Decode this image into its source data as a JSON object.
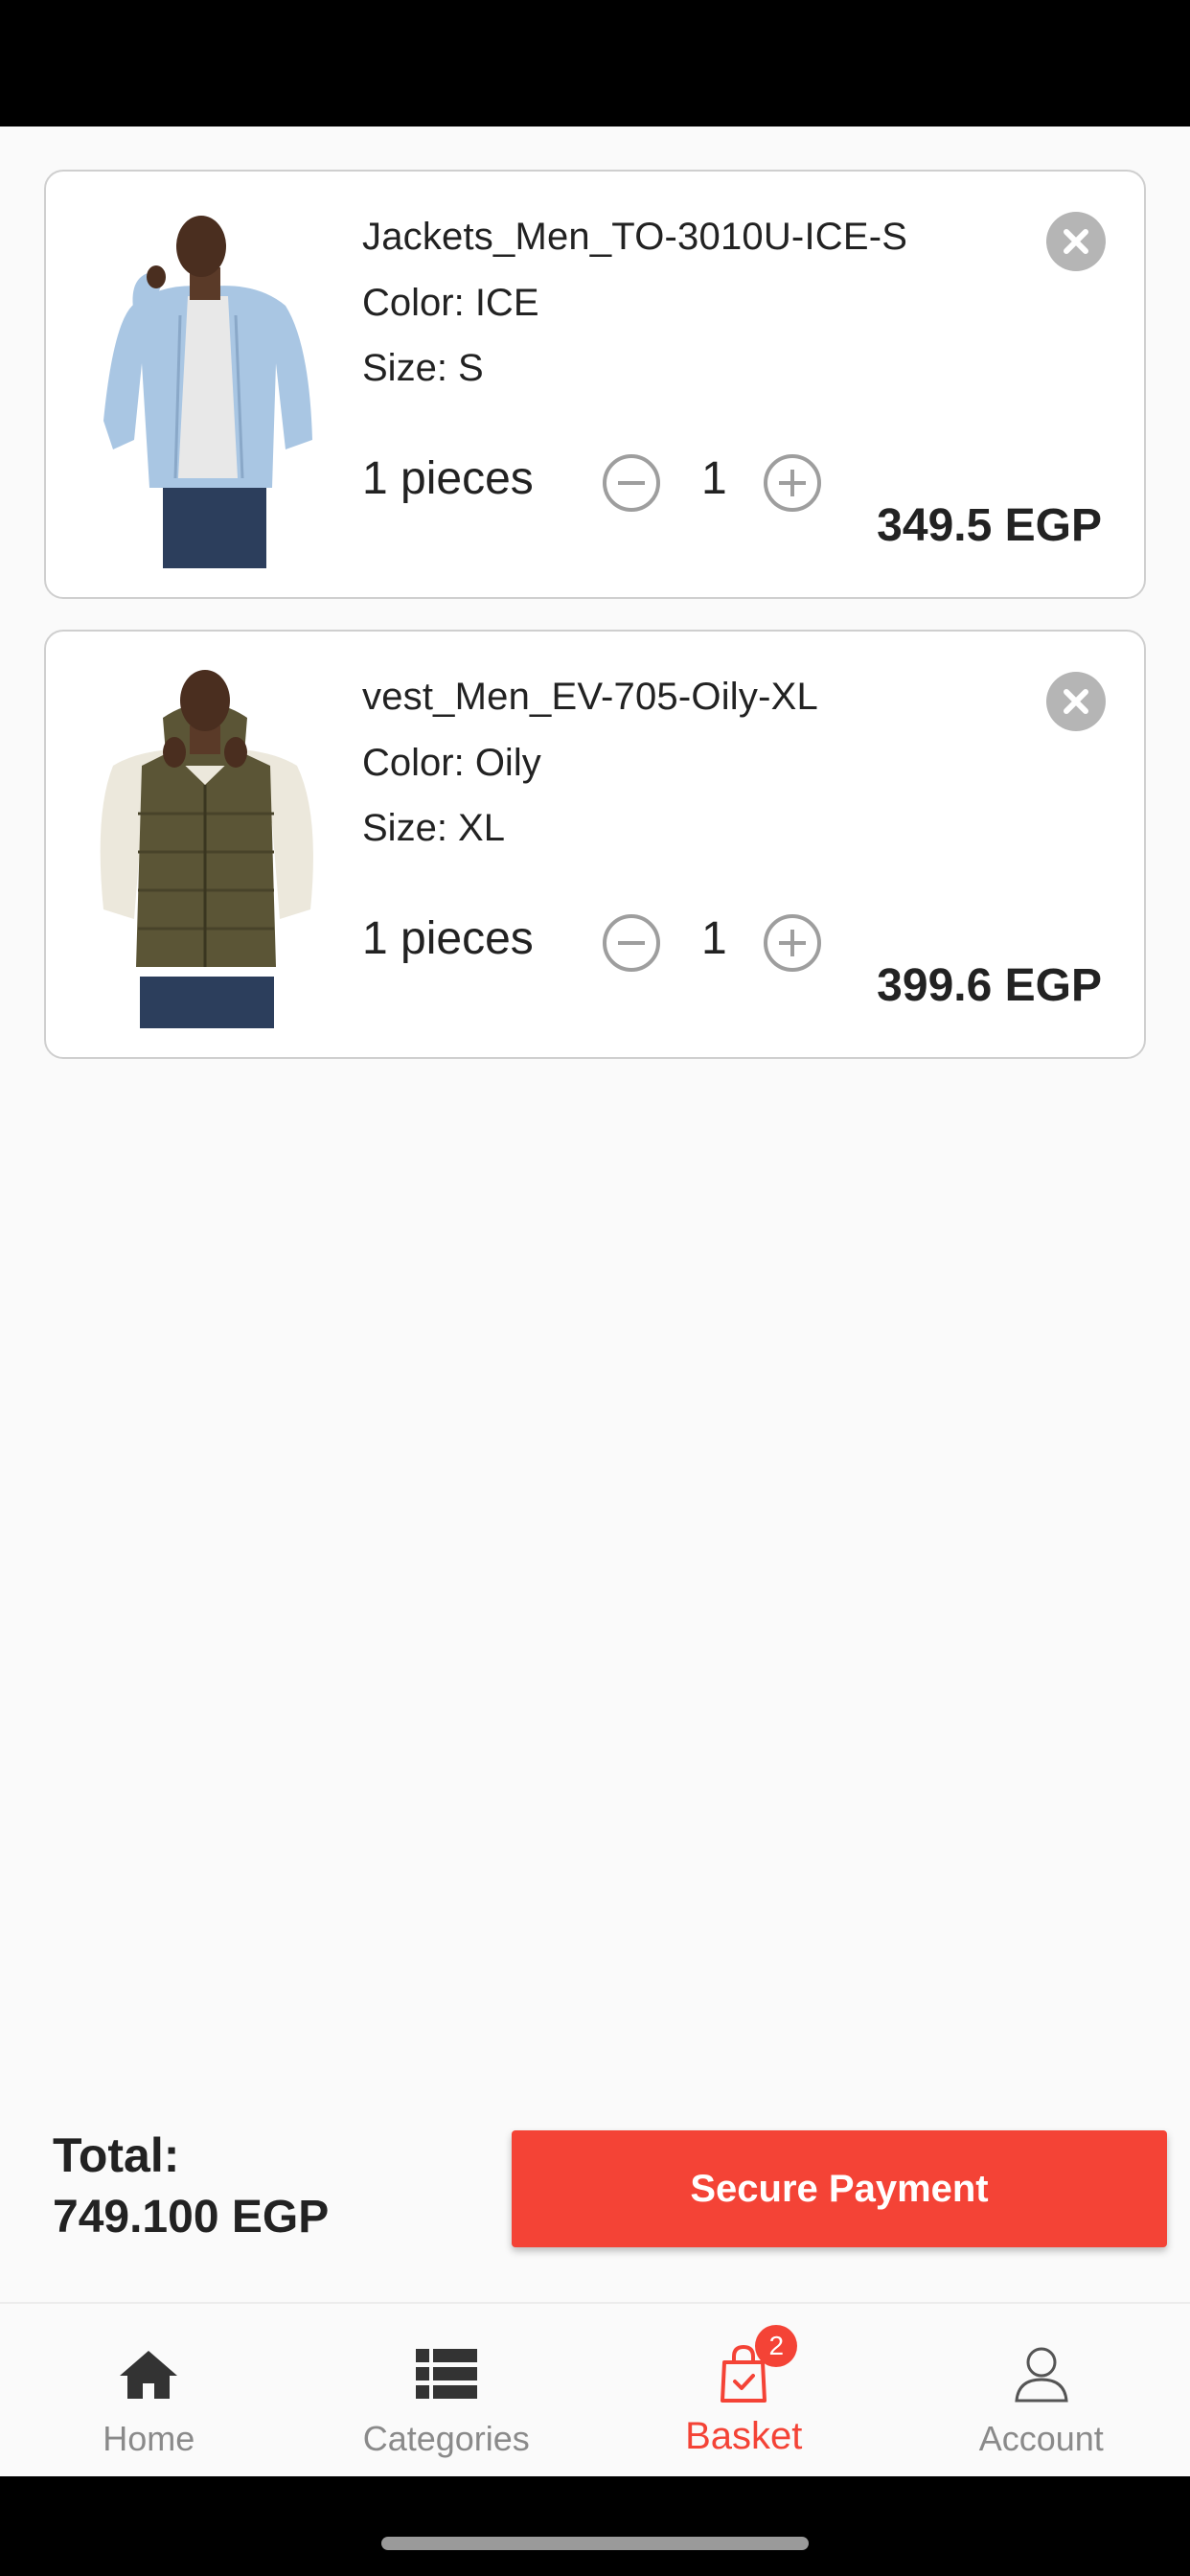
{
  "cart": {
    "items": [
      {
        "name": "Jackets_Men_TO-3010U-ICE-S",
        "color": "Color: ICE",
        "size": "Size: S",
        "pieces": "1 pieces",
        "quantity": "1",
        "price": "349.5 EGP"
      },
      {
        "name": "vest_Men_EV-705-Oily-XL",
        "color": "Color: Oily",
        "size": "Size: XL",
        "pieces": "1 pieces",
        "quantity": "1",
        "price": "399.6 EGP"
      }
    ]
  },
  "summary": {
    "total_label": "Total:",
    "total_value": "749.100 EGP",
    "pay_button": "Secure Payment"
  },
  "tabs": [
    {
      "label": "Home",
      "icon": "home-icon"
    },
    {
      "label": "Categories",
      "icon": "list-icon"
    },
    {
      "label": "Basket",
      "icon": "shopping-bag-icon",
      "badge": "2",
      "active": true
    },
    {
      "label": "Account",
      "icon": "user-icon"
    }
  ],
  "colors": {
    "accent": "#f44336",
    "inactive": "#8a8a8a",
    "remove": "#b5b5b5"
  }
}
